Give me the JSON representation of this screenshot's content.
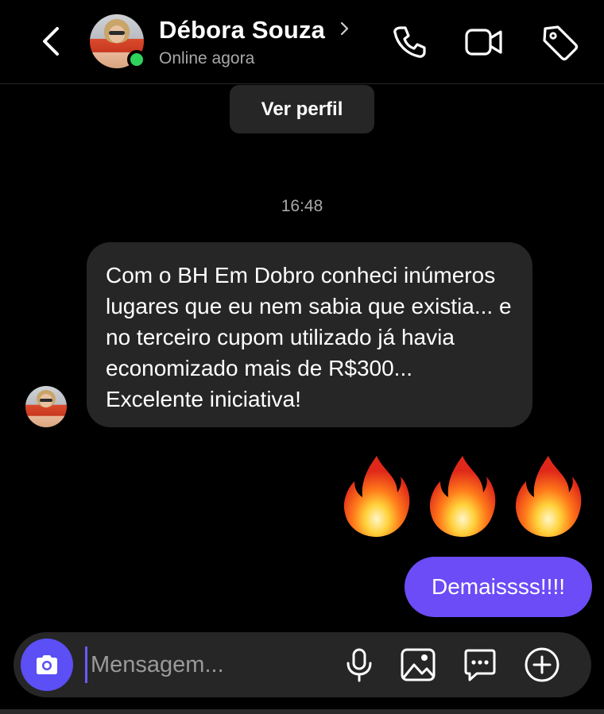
{
  "header": {
    "contact_name": "Débora Souza",
    "status": "Online agora",
    "online_color": "#2fd35c",
    "icons": [
      "back-icon",
      "chevron-right-icon",
      "phone-icon",
      "video-icon",
      "tag-icon"
    ]
  },
  "profile_button": {
    "label": "Ver perfil"
  },
  "conversation": {
    "timestamp": "16:48",
    "incoming_message": "Com o BH Em Dobro conheci inúmeros lugares que eu nem sabia que existia... e no terceiro cupom utilizado já havia economizado mais de R$300...  Excelente iniciativa!",
    "reaction_emojis": [
      "🔥",
      "🔥",
      "🔥"
    ],
    "outgoing_message": "Demaissss!!!!",
    "outgoing_color": "#6b4cf6"
  },
  "composer": {
    "placeholder": "Mensagem...",
    "value": "",
    "icons": [
      "camera-icon",
      "microphone-icon",
      "image-icon",
      "sticker-icon",
      "plus-icon"
    ],
    "accent": "#5b4ff5"
  }
}
